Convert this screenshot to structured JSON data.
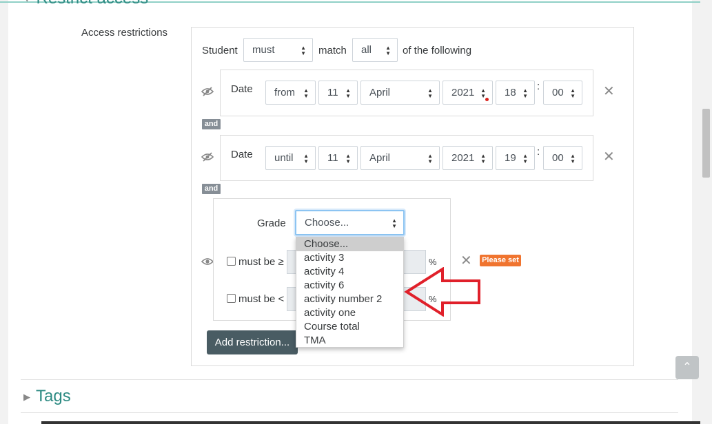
{
  "sections": {
    "restrict_access": "Restrict access",
    "tags": "Tags"
  },
  "field_label": "Access restrictions",
  "header_row": {
    "student": "Student",
    "must": "must",
    "match": "match",
    "all": "all",
    "of_following": "of the following"
  },
  "conditions": [
    {
      "type": "Date",
      "direction": "from",
      "day": "11",
      "month": "April",
      "year": "2021",
      "hour": "18",
      "minute": "00"
    },
    {
      "type": "Date",
      "direction": "until",
      "day": "11",
      "month": "April",
      "year": "2021",
      "hour": "19",
      "minute": "00"
    }
  ],
  "connector": "and",
  "colon": ":",
  "grade": {
    "label": "Grade",
    "selected": "Choose...",
    "min_label": "must be ≥",
    "max_label": "must be <",
    "percent": "%",
    "options": [
      "Choose...",
      "activity 3",
      "activity 4",
      "activity 6",
      "activity number 2",
      "activity one",
      "Course total",
      "TMA"
    ],
    "warning": "Please set"
  },
  "add_restriction_label": "Add restriction...",
  "colors": {
    "accent": "#2e8b83",
    "warning_bg": "#f0742f",
    "button_bg": "#495c63",
    "annotation_arrow": "#e0202a"
  },
  "icons": {
    "hidden_eye": "eye-slash-icon",
    "shown_eye": "eye-icon",
    "remove": "close-icon",
    "chevron": "chevron-right-icon",
    "updown": "sort-icon",
    "back_to_top": "arrow-up-icon"
  }
}
